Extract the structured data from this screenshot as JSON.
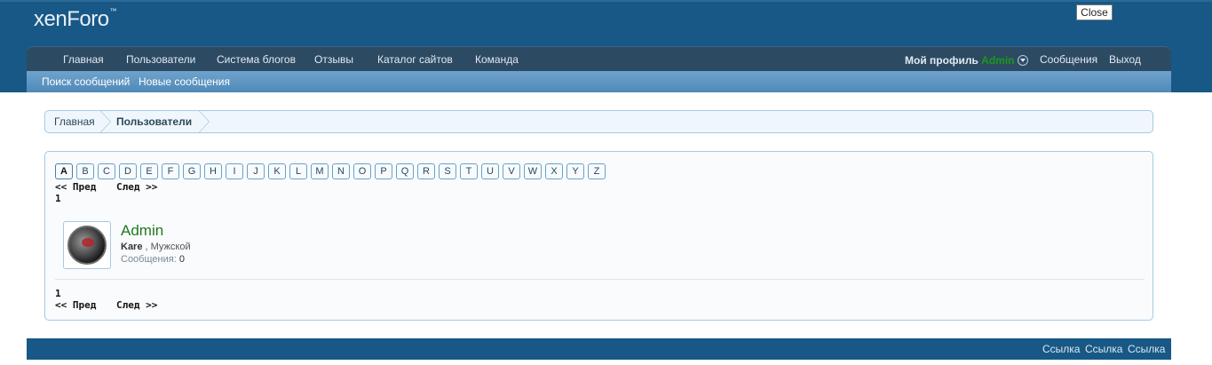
{
  "header": {
    "logo_text": "xenForo",
    "logo_mark": "™",
    "close_label": "Close"
  },
  "nav": {
    "tabs": [
      {
        "label": "Главная"
      },
      {
        "label": "Пользователи"
      },
      {
        "label": "Система блогов"
      },
      {
        "label": "Отзывы"
      },
      {
        "label": "Каталог сайтов"
      },
      {
        "label": "Команда"
      }
    ],
    "profile_label": "Мой профиль",
    "profile_user": "Admin",
    "messages_label": "Сообщения",
    "logout_label": "Выход"
  },
  "subnav": {
    "links": [
      {
        "label": "Поиск сообщений"
      },
      {
        "label": "Новые сообщения"
      }
    ]
  },
  "breadcrumb": {
    "home": "Главная",
    "current": "Пользователи"
  },
  "alphabet": {
    "letters": [
      "A",
      "B",
      "C",
      "D",
      "E",
      "F",
      "G",
      "H",
      "I",
      "J",
      "K",
      "L",
      "M",
      "N",
      "O",
      "P",
      "Q",
      "R",
      "S",
      "T",
      "U",
      "V",
      "W",
      "X",
      "Y",
      "Z"
    ],
    "active": "A"
  },
  "pager": {
    "prev": "<< Пред",
    "next": "След >>",
    "page": "1"
  },
  "member": {
    "name": "Admin",
    "title": "Kare",
    "gender": ", Мужской",
    "messages_label": "Сообщения:",
    "messages_count": "0"
  },
  "footer": {
    "links": [
      "Ссылка",
      "Ссылка",
      "Ссылка"
    ]
  },
  "colors": {
    "header_bg": "#185886",
    "nav_bg": "#2d4a63",
    "subnav_bg": "#5f97c2",
    "member_name": "#1f7a1f",
    "border": "#a5cae4"
  }
}
